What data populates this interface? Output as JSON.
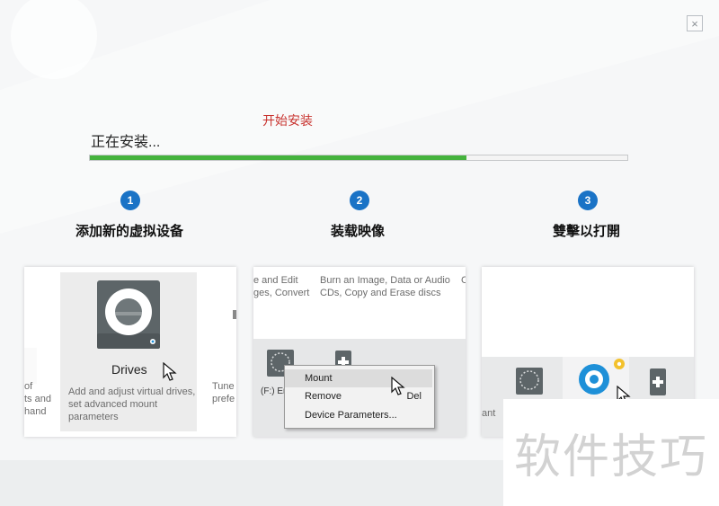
{
  "window": {
    "close_label": "×"
  },
  "annotation": {
    "text": "开始安装",
    "color": "#c8322e"
  },
  "install": {
    "status": "正在安装...",
    "progress": 0.7,
    "progress_color": "#45b33d"
  },
  "steps": [
    {
      "number": "1",
      "title": "添加新的虚拟设备"
    },
    {
      "number": "2",
      "title": "装载映像"
    },
    {
      "number": "3",
      "title": "雙擊以打開"
    }
  ],
  "card1": {
    "left_fragment": [
      "of",
      "ts and",
      "hand"
    ],
    "drives_label": "Drives",
    "drives_desc": [
      "Add and adjust virtual drives,",
      "set advanced mount",
      "parameters"
    ],
    "right_fragment": [
      "Tune",
      "prefe"
    ]
  },
  "card2": {
    "left_desc": [
      "e and Edit",
      "ges, Convert"
    ],
    "right_desc": [
      "Burn an Image, Data or Audio",
      "CDs, Copy and Erase discs"
    ],
    "edge_fragment": "C",
    "drive_label": "(F:) En",
    "menu": [
      {
        "label": "Mount",
        "shortcut": ""
      },
      {
        "label": "Remove",
        "shortcut": "Del"
      },
      {
        "label": "Device Parameters...",
        "shortcut": ""
      }
    ]
  },
  "card3": {
    "left_fragment": "ant"
  },
  "colors": {
    "step_blue": "#1a73c6",
    "drive_gray": "#5d6568",
    "accent_blue": "#1e90d8"
  },
  "watermark": {
    "text": "软件技巧"
  }
}
